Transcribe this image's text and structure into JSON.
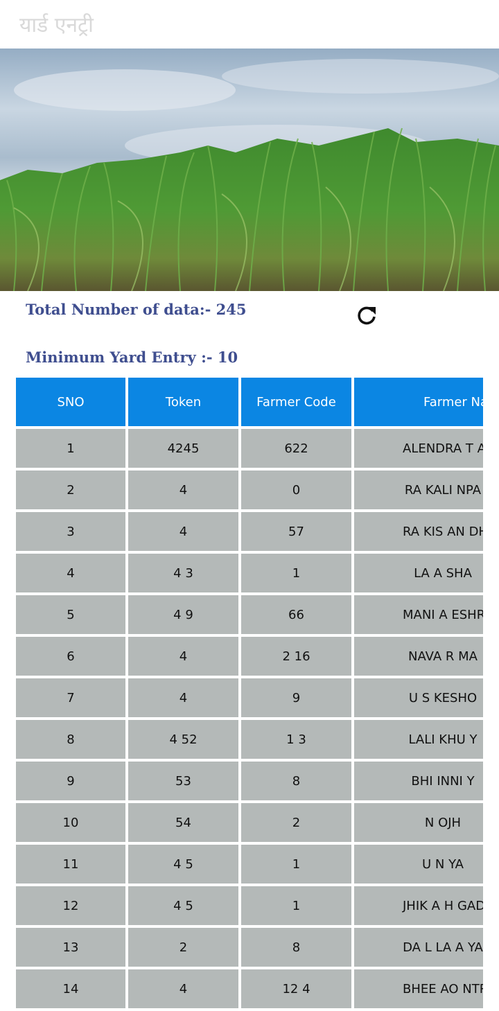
{
  "app_bar": {
    "title": "यार्ड एनट्री"
  },
  "banner": {
    "image": "sugarcane-field",
    "slides_total": 3,
    "active_slide": 3,
    "accent_color": "#f4511e"
  },
  "info": {
    "total_label": "Total Number of data:- 245",
    "min_entry_label": "Minimum Yard Entry :- 10",
    "refresh_icon": "refresh-icon"
  },
  "table": {
    "header_color": "#0b86e3",
    "row_color": "#b4b9b8",
    "columns": [
      "SNO",
      "Token",
      "Farmer Code",
      "Farmer Na"
    ],
    "rows": [
      {
        "sno": "1",
        "token": "4245",
        "code": "622",
        "name": "ALENDRA T AR"
      },
      {
        "sno": "2",
        "token": "4",
        "code": "0",
        "name": "RA KALI NPA"
      },
      {
        "sno": "3",
        "token": "4",
        "code": "57",
        "name": "RA KIS AN DH"
      },
      {
        "sno": "4",
        "token": "4 3",
        "code": "1",
        "name": "LA A SHA"
      },
      {
        "sno": "5",
        "token": "4 9",
        "code": "66",
        "name": "MANI A ESHR"
      },
      {
        "sno": "6",
        "token": "4",
        "code": "2 16",
        "name": "NAVA R MA"
      },
      {
        "sno": "7",
        "token": "4",
        "code": "9",
        "name": "U S KESHO"
      },
      {
        "sno": "8",
        "token": "4 52",
        "code": "1 3",
        "name": "LALI KHU Y"
      },
      {
        "sno": "9",
        "token": "53",
        "code": "8",
        "name": "BHI INNI Y"
      },
      {
        "sno": "10",
        "token": "54",
        "code": "2",
        "name": "N OJH"
      },
      {
        "sno": "11",
        "token": "4 5",
        "code": "1",
        "name": "U N YA"
      },
      {
        "sno": "12",
        "token": "4 5",
        "code": "1",
        "name": "JHIK A H GAD"
      },
      {
        "sno": "13",
        "token": "2",
        "code": "8",
        "name": "DA L LA A YA"
      },
      {
        "sno": "14",
        "token": "4",
        "code": "12 4",
        "name": "BHEE AO NTRA"
      }
    ]
  }
}
